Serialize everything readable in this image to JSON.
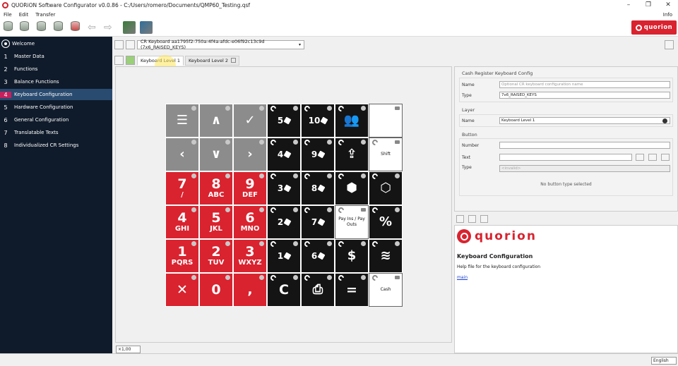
{
  "window": {
    "title": "QUORiON Software Configurator v0.0.86 - C:/Users/romero/Documents/QMP60_Testing.qsf",
    "controls": [
      "–",
      "❐",
      "✕"
    ]
  },
  "menu": {
    "items": [
      "File",
      "Edit",
      "Transfer"
    ],
    "info": "Info"
  },
  "toolbar": {
    "brand": "quorion",
    "back": "⇦",
    "forward": "⇨"
  },
  "sidebar": {
    "welcome": "Welcome",
    "items": [
      {
        "num": "1",
        "label": "Master Data"
      },
      {
        "num": "2",
        "label": "Functions"
      },
      {
        "num": "3",
        "label": "Balance Functions"
      },
      {
        "num": "4",
        "label": "Keyboard Configuration"
      },
      {
        "num": "5",
        "label": "Hardware Configuration"
      },
      {
        "num": "6",
        "label": "General Configuration"
      },
      {
        "num": "7",
        "label": "Translatable Texts"
      },
      {
        "num": "8",
        "label": "Individualized CR Settings"
      }
    ]
  },
  "workbar": {
    "keyboard_select": "CR Keyboard aa1795f2-750a-4f4a-afdc-e06f92c13c9d (7x6_RAISED_KEYS)",
    "caret": "▾"
  },
  "tabs": [
    {
      "label": "Keyboard Level 1"
    },
    {
      "label": "Keyboard Level 2"
    }
  ],
  "keyboard": {
    "keys": [
      {
        "style": "grey",
        "glyph": "☰"
      },
      {
        "style": "grey",
        "glyph": "∧"
      },
      {
        "style": "grey",
        "glyph": "✓"
      },
      {
        "style": "black",
        "qty": "5"
      },
      {
        "style": "black",
        "qty": "10"
      },
      {
        "style": "black",
        "glyph": "👥"
      },
      {
        "style": "white",
        "label": ""
      },
      {
        "style": "grey",
        "glyph": "‹"
      },
      {
        "style": "grey",
        "glyph": "∨"
      },
      {
        "style": "grey",
        "glyph": "›"
      },
      {
        "style": "black",
        "qty": "4"
      },
      {
        "style": "black",
        "qty": "9"
      },
      {
        "style": "black",
        "glyph": "⇪"
      },
      {
        "style": "white",
        "label": "Shift"
      },
      {
        "style": "red",
        "big": "7",
        "sub": "/"
      },
      {
        "style": "red",
        "big": "8",
        "sub": "ABC"
      },
      {
        "style": "red",
        "big": "9",
        "sub": "DEF"
      },
      {
        "style": "black",
        "qty": "3"
      },
      {
        "style": "black",
        "qty": "8"
      },
      {
        "style": "black",
        "glyph": "⬢"
      },
      {
        "style": "black",
        "glyph": "⬡"
      },
      {
        "style": "red",
        "big": "4",
        "sub": "GHI"
      },
      {
        "style": "red",
        "big": "5",
        "sub": "JKL"
      },
      {
        "style": "red",
        "big": "6",
        "sub": "MNO"
      },
      {
        "style": "black",
        "qty": "2"
      },
      {
        "style": "black",
        "qty": "7"
      },
      {
        "style": "white",
        "label": "Pay Ins / Pay Outs"
      },
      {
        "style": "black",
        "glyph": "%"
      },
      {
        "style": "red",
        "big": "1",
        "sub": "PQRS"
      },
      {
        "style": "red",
        "big": "2",
        "sub": "TUV"
      },
      {
        "style": "red",
        "big": "3",
        "sub": "WXYZ"
      },
      {
        "style": "black",
        "qty": "1"
      },
      {
        "style": "black",
        "qty": "6"
      },
      {
        "style": "black",
        "glyph": "$"
      },
      {
        "style": "black",
        "glyph": "≋"
      },
      {
        "style": "red",
        "big": "✕"
      },
      {
        "style": "red",
        "big": "0"
      },
      {
        "style": "red",
        "big": ","
      },
      {
        "style": "black",
        "big": "C"
      },
      {
        "style": "black",
        "glyph": "⎙"
      },
      {
        "style": "black",
        "big": "="
      },
      {
        "style": "white",
        "label": "Cash"
      }
    ]
  },
  "zoom": {
    "value": "×1,00"
  },
  "properties": {
    "section_config": "Cash Register Keyboard Config",
    "name_label": "Name",
    "name_placeholder": "Optional CR keyboard configuration name",
    "type_label": "Type",
    "type_value": "7x6_RAISED_KEYS",
    "section_layer": "Layer",
    "layer_name_label": "Name",
    "layer_name_value": "Keyboard Level 1",
    "section_button": "Button",
    "number_label": "Number",
    "text_label": "Text",
    "btype_label": "Type",
    "btype_value": "<invalid>",
    "no_selection": "No button type selected"
  },
  "help": {
    "brand": "quorion",
    "title": "Keyboard Configuration",
    "text": "Help file for the keyboard configuration",
    "link": "main"
  },
  "status": {
    "language": "English"
  }
}
